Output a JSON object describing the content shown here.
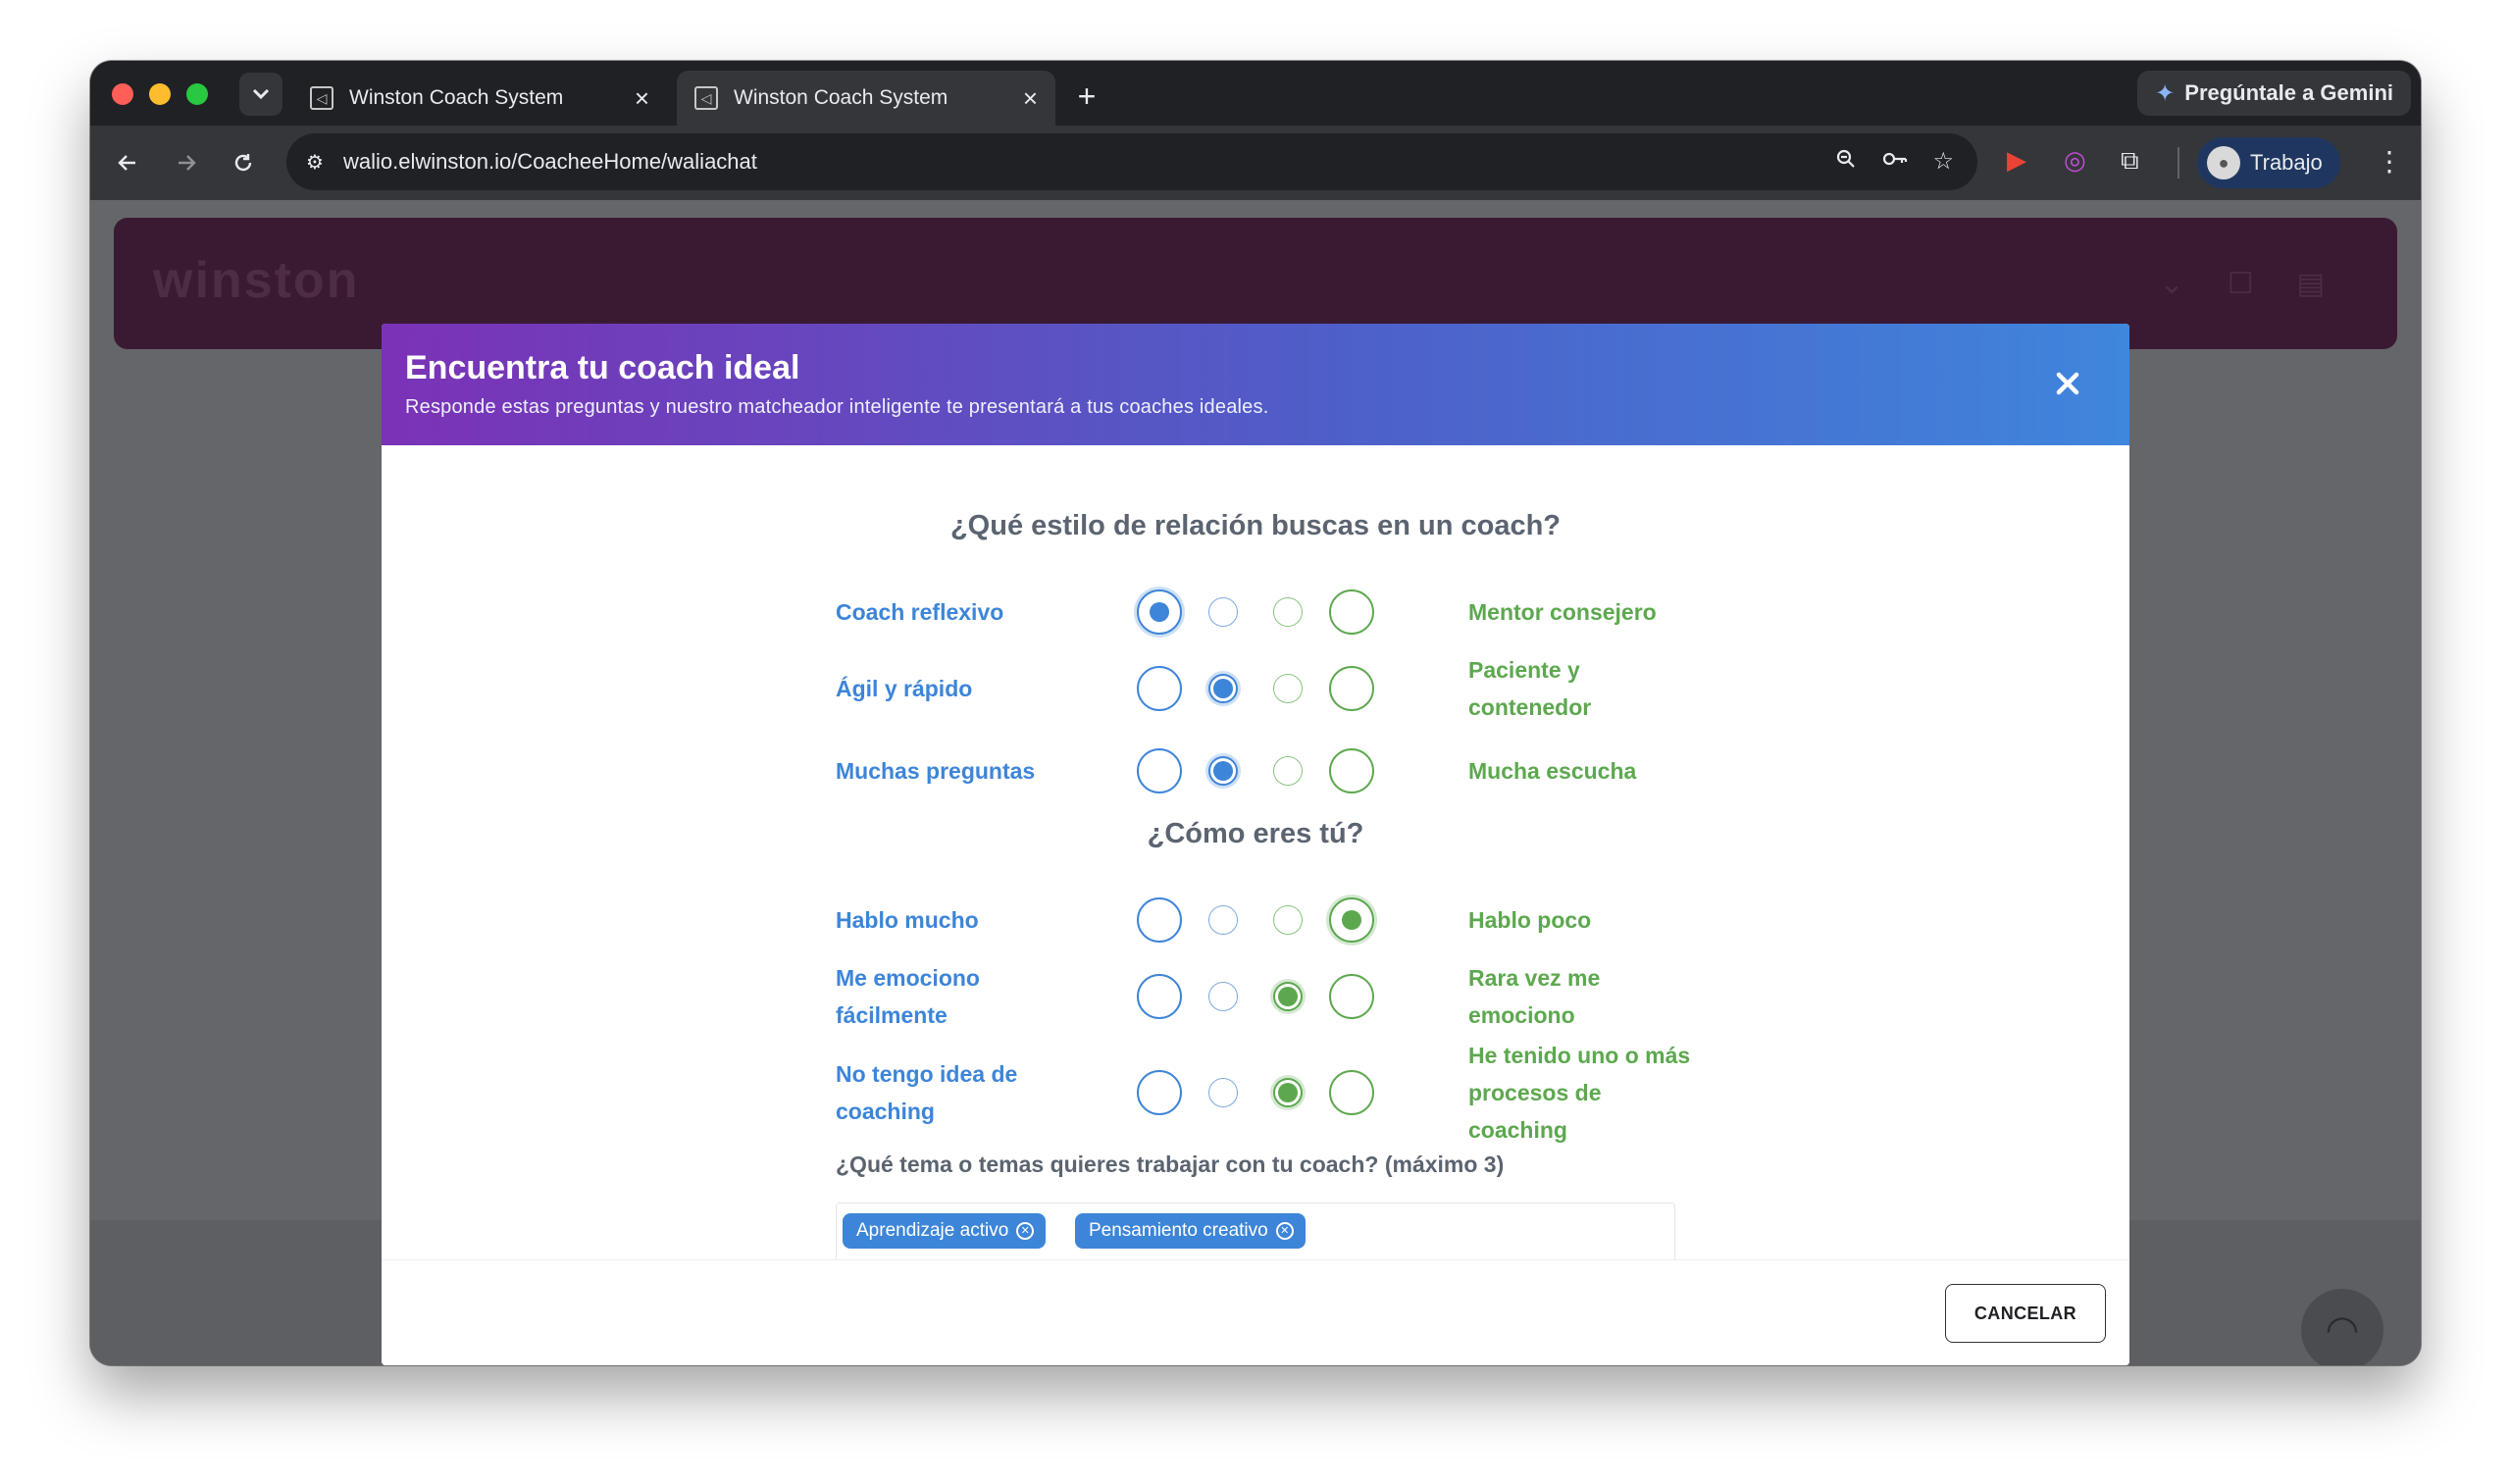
{
  "browser": {
    "tabs": [
      {
        "title": "Winston Coach System",
        "active": false
      },
      {
        "title": "Winston Coach System",
        "active": true
      }
    ],
    "new_tab_label": "+",
    "gemini_label": "Pregúntale a Gemini",
    "url": "walio.elwinston.io/CoacheeHome/waliachat",
    "profile_label": "Trabajo"
  },
  "background_page": {
    "logo_text": "winston"
  },
  "modal": {
    "title": "Encuentra tu coach ideal",
    "subtitle": "Responde estas preguntas y nuestro matcheador inteligente te presentará a tus coaches ideales.",
    "section1": {
      "title": "¿Qué estilo de relación buscas en un coach?",
      "rows": [
        {
          "left": "Coach reflexivo",
          "right": "Mentor consejero",
          "selected": 1
        },
        {
          "left": "Ágil y rápido",
          "right": "Paciente y contenedor",
          "selected": 2
        },
        {
          "left": "Muchas preguntas",
          "right": "Mucha escucha",
          "selected": 2
        }
      ]
    },
    "section2": {
      "title": "¿Cómo eres tú?",
      "rows": [
        {
          "left": "Hablo mucho",
          "right": "Hablo poco",
          "selected": 4
        },
        {
          "left": "Me emociono fácilmente",
          "right": "Rara vez me emociono",
          "selected": 3
        },
        {
          "left": "No tengo idea de coaching",
          "right": "He tenido uno o más procesos de coaching",
          "selected": 3
        }
      ]
    },
    "topics": {
      "label": "¿Qué tema o temas quieres trabajar con tu coach? (máximo 3)",
      "selected": [
        "Aprendizaje activo",
        "Pensamiento creativo"
      ]
    },
    "cancel_label": "CANCELAR"
  },
  "colors": {
    "left_label": "#3d85d8",
    "right_label": "#5da84f",
    "header_gradient_start": "#7b32b6",
    "header_gradient_end": "#3f86dd"
  }
}
